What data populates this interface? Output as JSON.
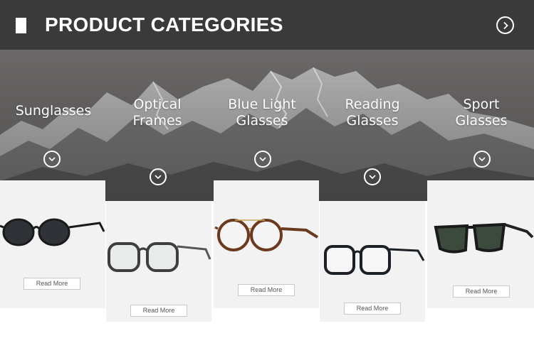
{
  "header": {
    "title": "PRODUCT CATEGORIES",
    "next_icon": "chevron-right-circle-icon"
  },
  "categories": [
    {
      "label": "Sunglasses",
      "icon": "chevron-down-circle-icon"
    },
    {
      "label": "Optical\nFrames",
      "icon": "chevron-down-circle-icon"
    },
    {
      "label": "Blue Light\nGlasses",
      "icon": "chevron-down-circle-icon"
    },
    {
      "label": "Reading\nGlasses",
      "icon": "chevron-down-circle-icon"
    },
    {
      "label": "Sport\nGlasses",
      "icon": "chevron-down-circle-icon"
    }
  ],
  "products": [
    {
      "read_more": "Read More"
    },
    {
      "read_more": "Read More"
    },
    {
      "read_more": "Read More"
    },
    {
      "read_more": "Read More"
    },
    {
      "read_more": "Read More"
    }
  ],
  "colors": {
    "header_bg": "#3a3a3a",
    "card_bg": "#f2f2f2",
    "text_light": "#ffffff"
  }
}
